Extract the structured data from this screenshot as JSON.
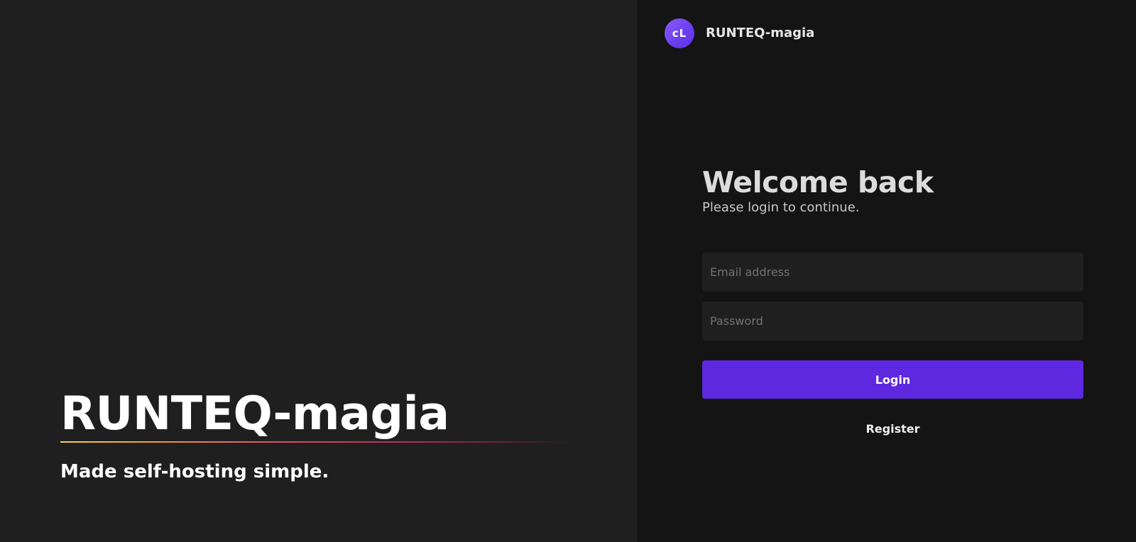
{
  "hero": {
    "title": "RUNTEQ-magia",
    "tagline": "Made self-hosting simple."
  },
  "brand": {
    "avatar_initials": "cL",
    "name": "RUNTEQ-magia"
  },
  "login": {
    "title": "Welcome back",
    "subtitle": "Please login to continue.",
    "email_placeholder": "Email address",
    "password_placeholder": "Password",
    "login_label": "Login",
    "register_label": "Register"
  },
  "colors": {
    "left_background": "#1f1f1f",
    "right_background": "#141414",
    "accent": "#5e28e1",
    "avatar": "#7044f2",
    "input_background": "#1f1f1f"
  }
}
